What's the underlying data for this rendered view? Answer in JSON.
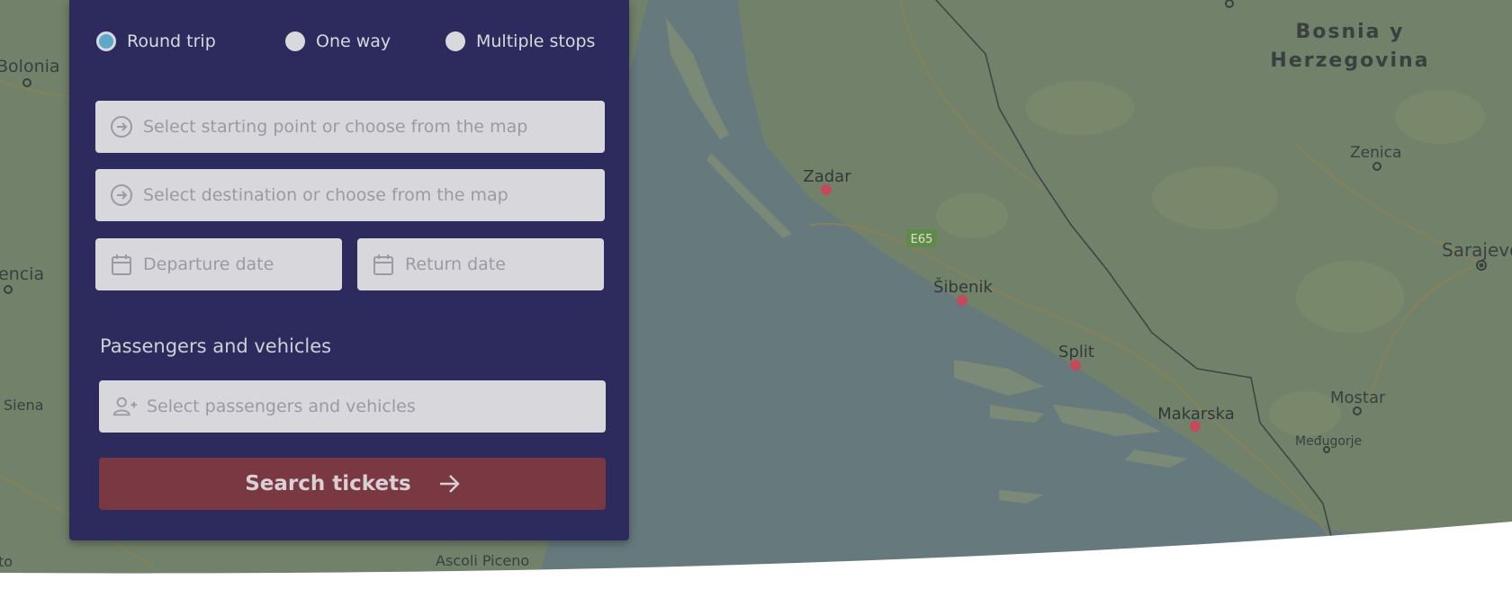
{
  "trip_type": {
    "options": [
      {
        "label": "Round trip",
        "selected": true
      },
      {
        "label": "One way",
        "selected": false
      },
      {
        "label": "Multiple stops",
        "selected": false
      }
    ]
  },
  "route": {
    "origin_placeholder": "Select starting point or choose from the map",
    "destination_placeholder": "Select destination or choose from the map",
    "departure_placeholder": "Departure date",
    "return_placeholder": "Return date"
  },
  "passengers": {
    "heading": "Passengers and vehicles",
    "placeholder": "Select passengers and vehicles"
  },
  "search_button": {
    "label": "Search tickets"
  },
  "map": {
    "ports": [
      "Zadar",
      "Šibenik",
      "Split",
      "Makarska"
    ],
    "places": [
      "Bolonia",
      "encia",
      "Siena",
      "to",
      "Ascoli Piceno",
      "Zenica",
      "Sarajevo",
      "Mostar",
      "Međugorje"
    ],
    "country": [
      "Bosnia y",
      "Herzegovina"
    ],
    "road_badge": "E65"
  },
  "colors": {
    "panel": "#2d2b5e",
    "button": "#7a3843",
    "selected_radio": "#5ea8c8",
    "port_marker": "#c44a5a"
  }
}
